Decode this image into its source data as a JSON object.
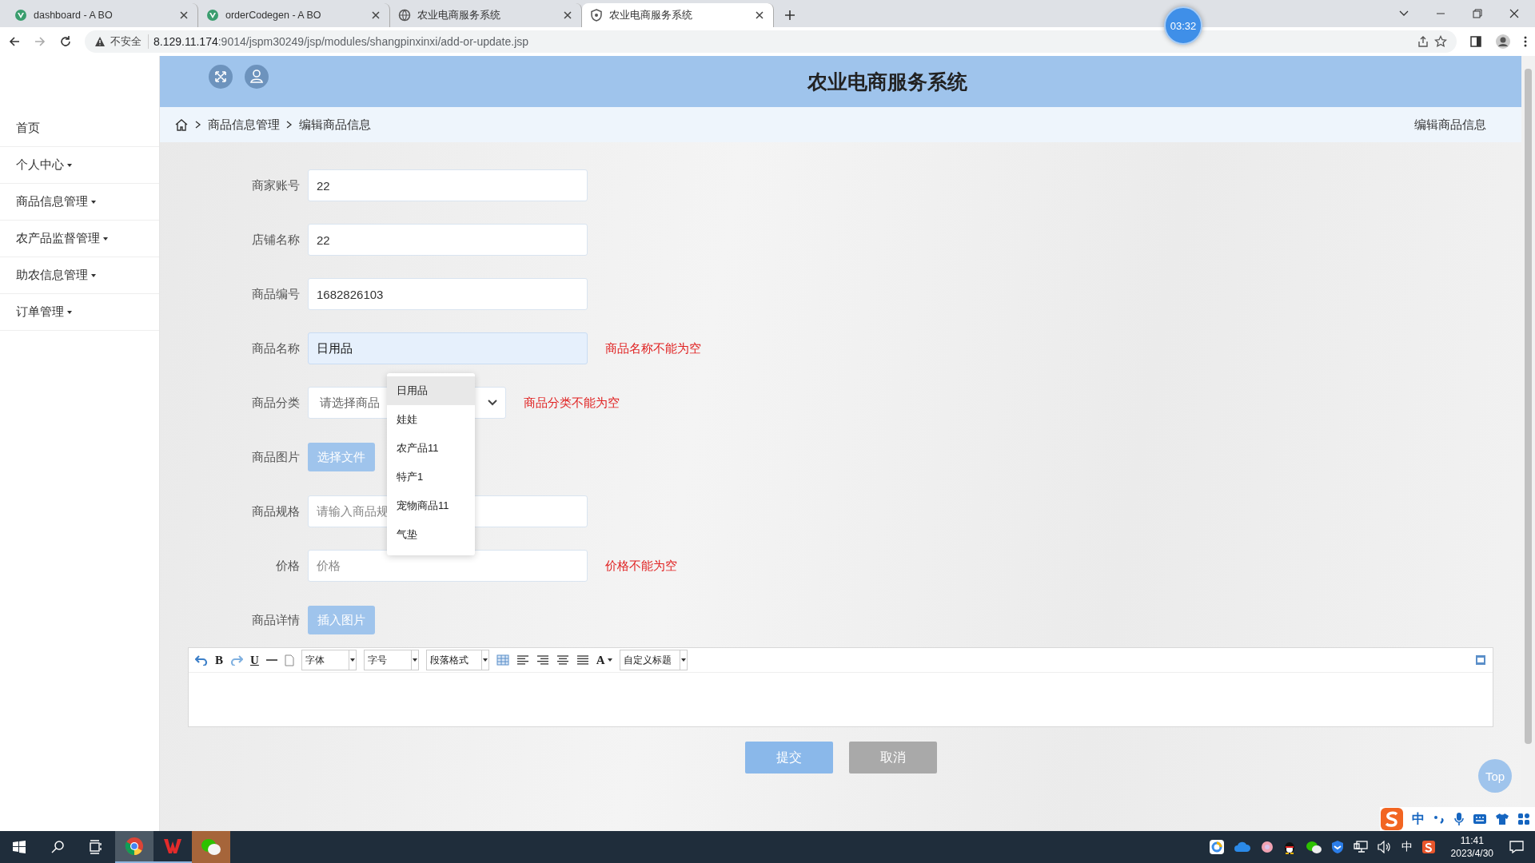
{
  "browser": {
    "tabs": [
      {
        "title": "dashboard - A BO",
        "selected": false
      },
      {
        "title": "orderCodegen - A BO",
        "selected": false
      },
      {
        "title": "农业电商服务系统",
        "selected": false
      },
      {
        "title": "农业电商服务系统",
        "selected": true
      }
    ],
    "security": "不安全",
    "url_host": "8.129.11.174",
    "url_path": ":9014/jspm30249/jsp/modules/shangpinxinxi/add-or-update.jsp",
    "timer": "03:32"
  },
  "sidebar": {
    "items": [
      {
        "label": "首页",
        "expandable": false
      },
      {
        "label": "个人中心",
        "expandable": true
      },
      {
        "label": "商品信息管理",
        "expandable": true
      },
      {
        "label": "农产品监督管理",
        "expandable": true
      },
      {
        "label": "助农信息管理",
        "expandable": true
      },
      {
        "label": "订单管理",
        "expandable": true
      }
    ]
  },
  "header": {
    "title": "农业电商服务系统"
  },
  "breadcrumb": {
    "items": [
      "商品信息管理",
      "编辑商品信息"
    ],
    "page_title": "编辑商品信息"
  },
  "form": {
    "fields": [
      {
        "kind": "input",
        "label": "商家账号",
        "value": "22",
        "focused": false
      },
      {
        "kind": "input",
        "label": "店铺名称",
        "value": "22",
        "focused": false
      },
      {
        "kind": "input",
        "label": "商品编号",
        "value": "1682826103",
        "focused": false
      },
      {
        "kind": "input",
        "label": "商品名称",
        "value": "日用品",
        "focused": true,
        "error": "商品名称不能为空"
      },
      {
        "kind": "select",
        "label": "商品分类",
        "placeholder": "请选择商品",
        "error": "商品分类不能为空"
      },
      {
        "kind": "file",
        "label": "商品图片",
        "button": "选择文件"
      },
      {
        "kind": "input",
        "label": "商品规格",
        "placeholder": "请输入商品规",
        "focused": false
      },
      {
        "kind": "input",
        "label": "价格",
        "placeholder": "价格",
        "focused": false,
        "error": "价格不能为空"
      },
      {
        "kind": "file",
        "label": "商品详情",
        "button": "插入图片"
      }
    ],
    "suggestions": [
      {
        "label": "日用品",
        "selected": true
      },
      {
        "label": "娃娃",
        "selected": false
      },
      {
        "label": "农产品11",
        "selected": false
      },
      {
        "label": "特产1",
        "selected": false
      },
      {
        "label": "宠物商品11",
        "selected": false
      },
      {
        "label": "气垫",
        "selected": false
      }
    ]
  },
  "editor": {
    "bold": "B",
    "underline": "U",
    "font_color": "A",
    "dropdowns": [
      "字体",
      "字号",
      "段落格式",
      "自定义标题"
    ]
  },
  "actions": {
    "submit": "提交",
    "cancel": "取消",
    "top": "Top"
  },
  "ime": {
    "mode": "中"
  },
  "taskbar": {
    "ime": "中",
    "time": "11:41",
    "date": "2023/4/30"
  }
}
